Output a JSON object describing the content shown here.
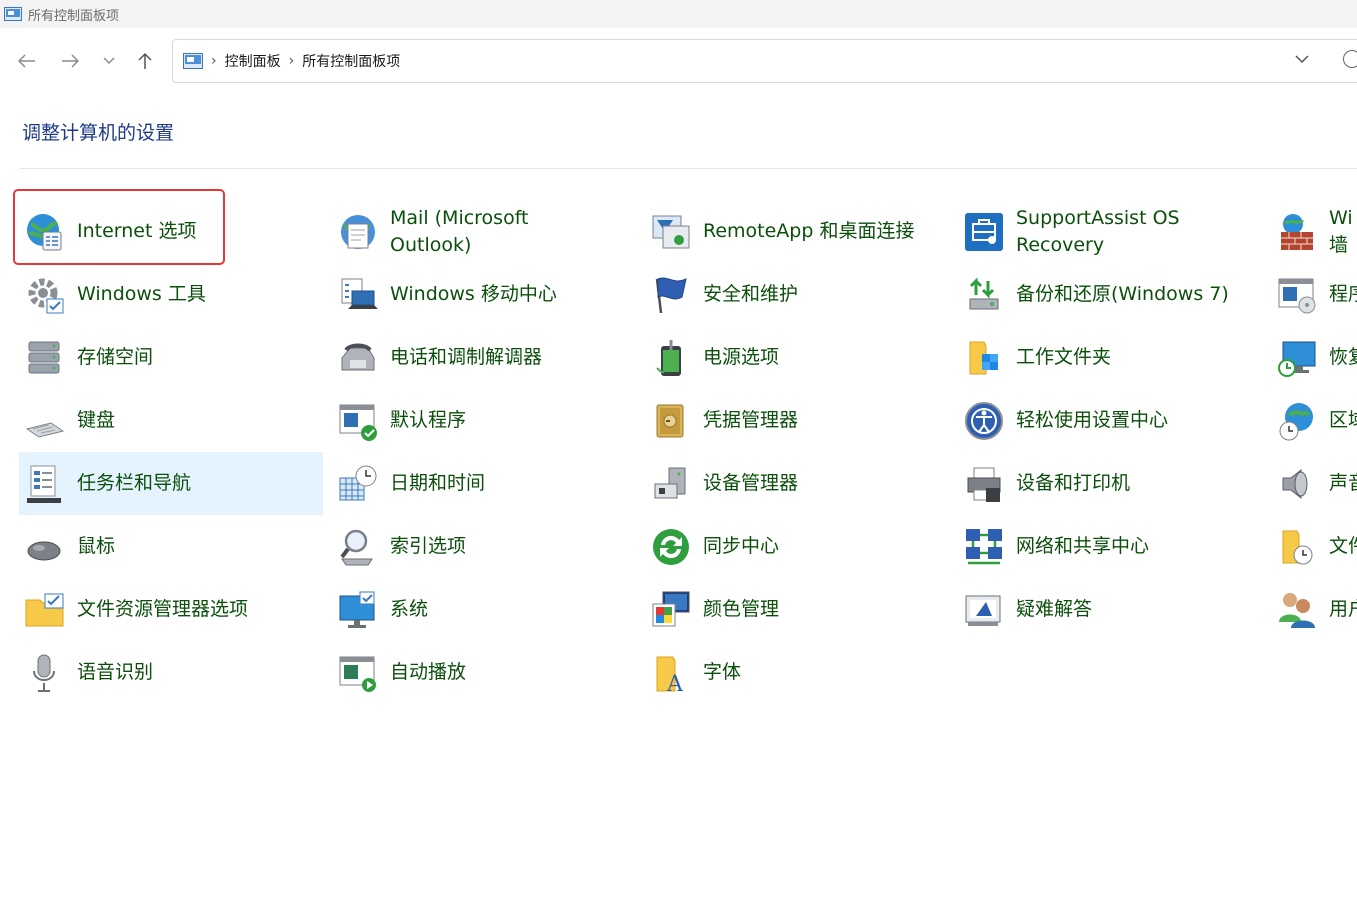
{
  "window": {
    "title": "所有控制面板项"
  },
  "address_bar": {
    "crumbs": [
      "控制面板",
      "所有控制面板项"
    ]
  },
  "heading": "调整计算机的设置",
  "items": [
    {
      "label": "Internet 选项",
      "icon": "internet-options-icon"
    },
    {
      "label": "Windows 工具",
      "icon": "windows-tools-icon"
    },
    {
      "label": "存储空间",
      "icon": "storage-spaces-icon"
    },
    {
      "label": "键盘",
      "icon": "keyboard-icon"
    },
    {
      "label": "任务栏和导航",
      "icon": "taskbar-icon"
    },
    {
      "label": "鼠标",
      "icon": "mouse-icon"
    },
    {
      "label": "文件资源管理器选项",
      "icon": "folder-options-icon"
    },
    {
      "label": "语音识别",
      "icon": "microphone-icon"
    },
    {
      "label": "Mail (Microsoft\nOutlook)",
      "icon": "mail-icon"
    },
    {
      "label": "Windows 移动中心",
      "icon": "mobility-center-icon"
    },
    {
      "label": "电话和调制解调器",
      "icon": "phone-modem-icon"
    },
    {
      "label": "默认程序",
      "icon": "default-programs-icon"
    },
    {
      "label": "日期和时间",
      "icon": "date-time-icon"
    },
    {
      "label": "索引选项",
      "icon": "indexing-icon"
    },
    {
      "label": "系统",
      "icon": "system-icon"
    },
    {
      "label": "自动播放",
      "icon": "autoplay-icon"
    },
    {
      "label": "RemoteApp 和桌面连接",
      "icon": "remoteapp-icon"
    },
    {
      "label": "安全和维护",
      "icon": "security-flag-icon"
    },
    {
      "label": "电源选项",
      "icon": "power-icon"
    },
    {
      "label": "凭据管理器",
      "icon": "credential-icon"
    },
    {
      "label": "设备管理器",
      "icon": "device-manager-icon"
    },
    {
      "label": "同步中心",
      "icon": "sync-icon"
    },
    {
      "label": "颜色管理",
      "icon": "color-management-icon"
    },
    {
      "label": "字体",
      "icon": "fonts-icon"
    },
    {
      "label": "SupportAssist OS\nRecovery",
      "icon": "supportassist-icon"
    },
    {
      "label": "备份和还原(Windows 7)",
      "icon": "backup-icon"
    },
    {
      "label": "工作文件夹",
      "icon": "work-folders-icon"
    },
    {
      "label": "轻松使用设置中心",
      "icon": "ease-of-access-icon"
    },
    {
      "label": "设备和打印机",
      "icon": "printer-icon"
    },
    {
      "label": "网络和共享中心",
      "icon": "network-icon"
    },
    {
      "label": "疑难解答",
      "icon": "troubleshooting-icon"
    },
    {
      "label": "Wi\n墙",
      "icon": "firewall-icon"
    },
    {
      "label": "程序",
      "icon": "programs-icon"
    },
    {
      "label": "恢复",
      "icon": "recovery-icon"
    },
    {
      "label": "区域",
      "icon": "region-icon"
    },
    {
      "label": "声音",
      "icon": "sound-icon"
    },
    {
      "label": "文件",
      "icon": "file-history-icon"
    },
    {
      "label": "用户",
      "icon": "user-accounts-icon"
    }
  ]
}
